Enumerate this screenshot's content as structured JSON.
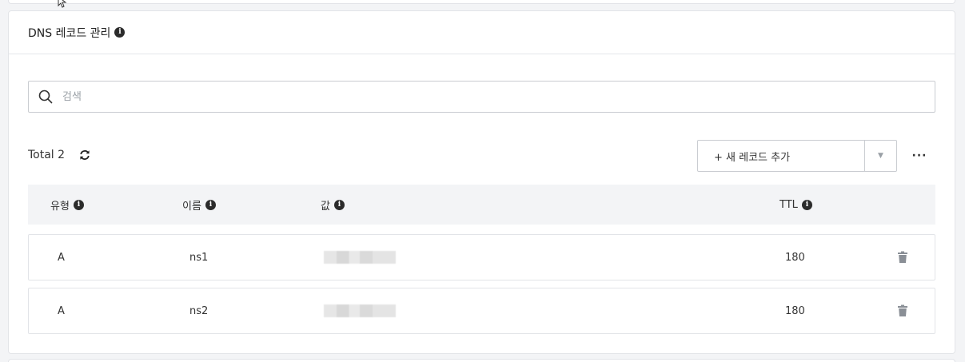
{
  "header": {
    "title": "DNS 레코드 관리"
  },
  "search": {
    "placeholder": "검색",
    "value": ""
  },
  "toolbar": {
    "total_label": "Total 2",
    "add_record_label": "+ 새 레코드 추가",
    "more_label": "···"
  },
  "table": {
    "columns": [
      "유형",
      "이름",
      "값",
      "TTL"
    ],
    "rows": [
      {
        "type": "A",
        "name": "ns1",
        "value_hidden": true,
        "ttl": "180"
      },
      {
        "type": "A",
        "name": "ns2",
        "value_hidden": true,
        "ttl": "180"
      }
    ]
  },
  "icons": {
    "info": "info-icon",
    "search": "search-icon",
    "refresh": "refresh-icon",
    "dropdown": "chevron-down-icon",
    "delete": "trash-icon"
  },
  "colors": {
    "header_bg": "#f3f4f6",
    "border": "#e2e4e8",
    "icon_dark": "#2b2b2b",
    "trash": "#8a8f96"
  }
}
